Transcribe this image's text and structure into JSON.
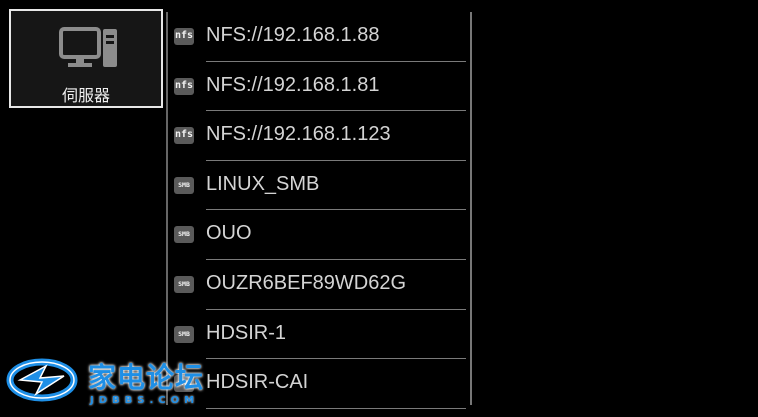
{
  "sidebar": {
    "server_tile": {
      "label": "伺服器",
      "icon": "desktop-computer-icon"
    }
  },
  "server_list": [
    {
      "type": "nfs",
      "badge": "nfs",
      "label": "NFS://192.168.1.88"
    },
    {
      "type": "nfs",
      "badge": "nfs",
      "label": "NFS://192.168.1.81"
    },
    {
      "type": "nfs",
      "badge": "nfs",
      "label": "NFS://192.168.1.123"
    },
    {
      "type": "smb",
      "badge": "SMB",
      "label": "LINUX_SMB"
    },
    {
      "type": "smb",
      "badge": "SMB",
      "label": "OUO"
    },
    {
      "type": "smb",
      "badge": "SMB",
      "label": "OUZR6BEF89WD62G"
    },
    {
      "type": "smb",
      "badge": "SMB",
      "label": "HDSIR-1"
    },
    {
      "type": "smb",
      "badge": "SMB",
      "label": "HDSIR-CAI"
    }
  ],
  "watermark": {
    "title": "家电论坛",
    "subtitle": "JDBBS.COM"
  },
  "colors": {
    "background": "#000000",
    "tile_border": "#e8e8e8",
    "badge": "#5a5a5a",
    "watermark": "#1e8fe6"
  }
}
